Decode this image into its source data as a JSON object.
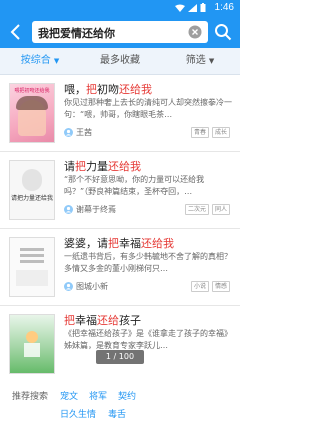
{
  "status": {
    "time": "1:46"
  },
  "search": {
    "query": "我把爱情还给你"
  },
  "tabs": [
    {
      "label": "按综合",
      "active": true
    },
    {
      "label": "最多收藏",
      "active": false
    },
    {
      "label": "筛选",
      "active": false
    }
  ],
  "results": [
    {
      "title_pre": "喂，",
      "title_hl": "把",
      "title_mid": "初吻",
      "title_hl2": "还给我",
      "title_post": "",
      "cover_label": "喂把初吻还给我",
      "desc": "你见过那种奢上去长的清纯可人却突然擦拳冷一句：“喂，帅哥，你瞎眼毛茶…",
      "author": "王茜",
      "tags": [
        "青春",
        "成长"
      ]
    },
    {
      "title_pre": "请",
      "title_hl": "把",
      "title_mid": "力量",
      "title_hl2": "还给我",
      "title_post": "",
      "cover_label": "请把力量还给我",
      "desc": "“那个不好意思呦，你的力量可以还给我吗？”（野良神篇结束，圣杯夺回，…",
      "author": "谢幕于终焉",
      "tags": [
        "二次元",
        "同人"
      ]
    },
    {
      "title_pre": "婆婆，请",
      "title_hl": "把",
      "title_mid": "幸福",
      "title_hl2": "还给我",
      "title_post": "",
      "cover_label": "",
      "desc": "一纸遗书背后，有多少韩毓地不舍了解的真相？多情又多金的董小刚梯何只…",
      "author": "图城小新",
      "tags": [
        "小说",
        "情感"
      ]
    },
    {
      "title_pre": "",
      "title_hl": "把",
      "title_mid": "幸福",
      "title_hl2": "还给",
      "title_post": "孩子",
      "cover_label": "",
      "desc": "《把幸福还给孩子》是《谁拿走了孩子的幸福》姊妹篇，是教育专家李跃儿…",
      "author": "",
      "tags": []
    }
  ],
  "pager": "1 / 100",
  "recommend": {
    "label": "推荐搜索",
    "keywords": [
      "宠文",
      "将军",
      "契约",
      "日久生情",
      "毒舌"
    ]
  }
}
